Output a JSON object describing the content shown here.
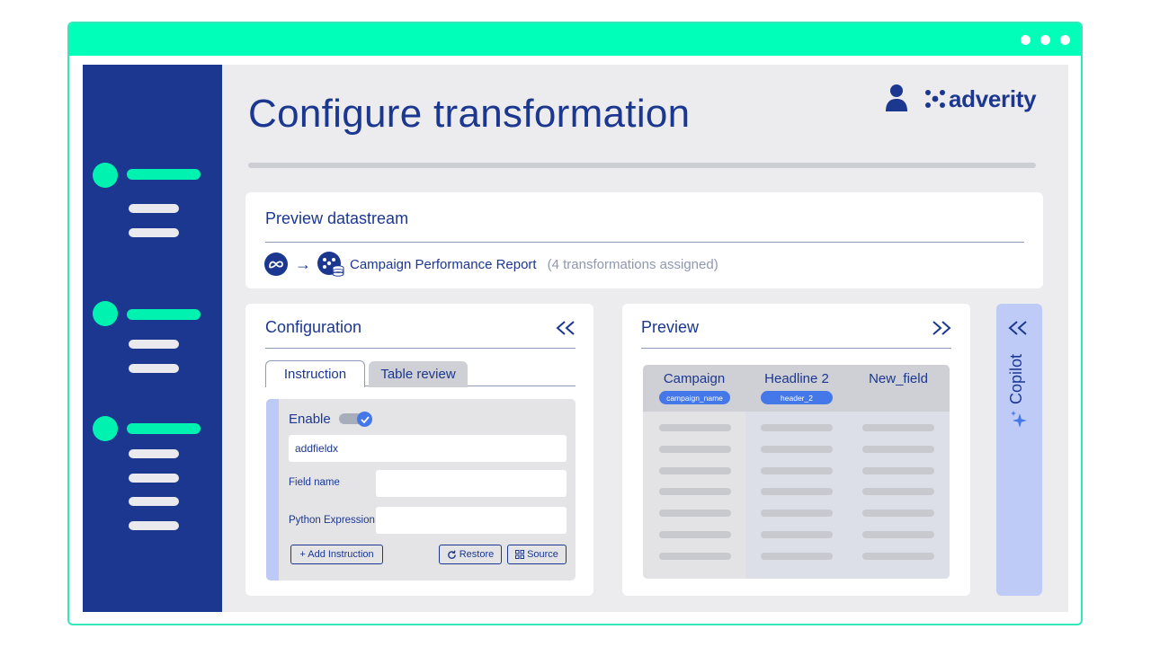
{
  "header": {
    "title": "Configure transformation",
    "brand": "adverity",
    "user_icon": "user-icon"
  },
  "preview_datastream": {
    "title": "Preview datastream",
    "source_icon": "meta-icon",
    "arrow": "→",
    "datastream_name": "Campaign Performance Report",
    "note": "(4 transformations assigned)"
  },
  "configuration": {
    "title": "Configuration",
    "collapse_icon": "chevron-double-left-icon",
    "tabs": [
      {
        "label": "Instruction",
        "active": true
      },
      {
        "label": "Table review",
        "active": false
      }
    ],
    "enable_label": "Enable",
    "enabled": true,
    "instruction_value": "addfieldx",
    "field_name_label": "Field name",
    "field_name_value": "",
    "python_expression_label": "Python Expression",
    "python_expression_value": "",
    "add_instruction_label": "+ Add Instruction",
    "restore_label": "Restore",
    "source_label": "Source"
  },
  "preview": {
    "title": "Preview",
    "expand_icon": "chevron-double-right-icon",
    "columns": [
      {
        "header": "Campaign",
        "tag": "campaign_name"
      },
      {
        "header": "Headline 2",
        "tag": "header_2"
      },
      {
        "header": "New_field",
        "tag": ""
      }
    ]
  },
  "copilot": {
    "label": "Copilot",
    "icon": "sparkle-icon",
    "collapse_icon": "chevron-double-left-icon"
  },
  "colors": {
    "brand_navy": "#1b3790",
    "accent_green": "#00ffb8",
    "accent_blue": "#4478e8",
    "copilot_bg": "#bfcbf7"
  }
}
